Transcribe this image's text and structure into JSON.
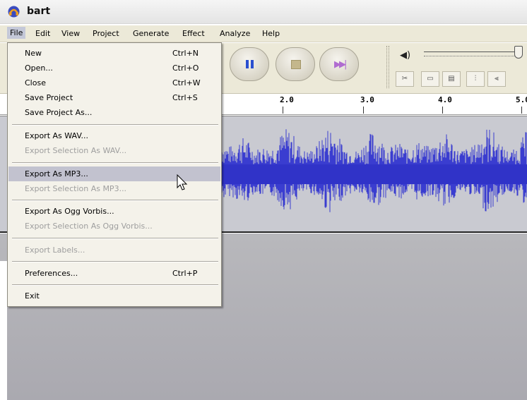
{
  "window": {
    "title": "bart"
  },
  "menubar": [
    "File",
    "Edit",
    "View",
    "Project",
    "Generate",
    "Effect",
    "Analyze",
    "Help"
  ],
  "icons": {
    "app_logo": "audacity-logo-icon",
    "pause": "pause-icon",
    "stop": "stop-icon",
    "skip_end": "skip-to-end-icon",
    "speaker": "speaker-icon",
    "cursor": "mouse-pointer-icon"
  },
  "colors": {
    "waveform": "#3a3dd0",
    "menu_highlight": "#c2c2cf",
    "track_bg": "#c9cad1"
  },
  "ruler": {
    "labels": [
      "2.0",
      "3.0",
      "4.0",
      "5.0"
    ]
  },
  "file_menu": {
    "new": {
      "label": "New",
      "shortcut": "Ctrl+N"
    },
    "open": {
      "label": "Open...",
      "shortcut": "Ctrl+O"
    },
    "close": {
      "label": "Close",
      "shortcut": "Ctrl+W"
    },
    "save_project": {
      "label": "Save Project",
      "shortcut": "Ctrl+S"
    },
    "save_project_as": {
      "label": "Save Project As..."
    },
    "export_wav": {
      "label": "Export As WAV..."
    },
    "export_selection_wav": {
      "label": "Export Selection As WAV..."
    },
    "export_mp3": {
      "label": "Export As MP3..."
    },
    "export_selection_mp3": {
      "label": "Export Selection As MP3..."
    },
    "export_ogg": {
      "label": "Export As Ogg Vorbis..."
    },
    "export_selection_ogg": {
      "label": "Export Selection As Ogg Vorbis..."
    },
    "export_labels": {
      "label": "Export Labels..."
    },
    "preferences": {
      "label": "Preferences...",
      "shortcut": "Ctrl+P"
    },
    "exit": {
      "label": "Exit"
    }
  }
}
